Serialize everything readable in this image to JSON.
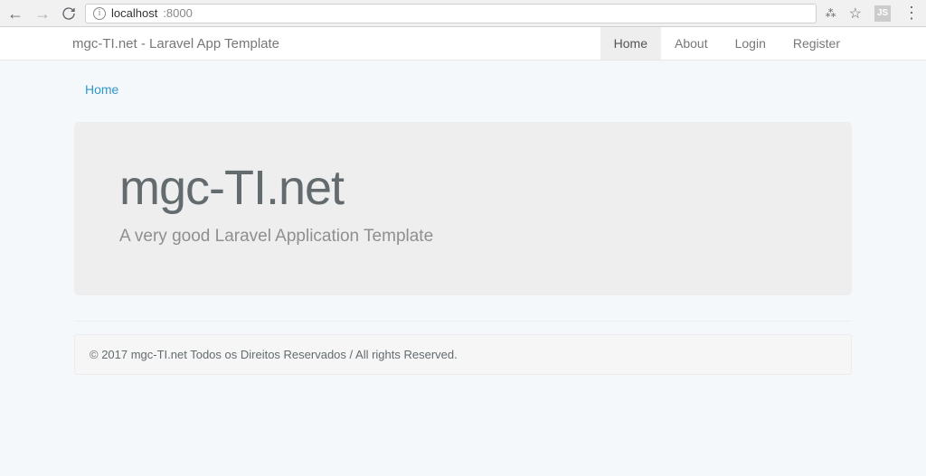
{
  "browser": {
    "url_host": "localhost",
    "url_port": ":8000"
  },
  "navbar": {
    "brand": "mgc-TI.net - Laravel App Template",
    "items": [
      {
        "label": "Home",
        "active": true
      },
      {
        "label": "About",
        "active": false
      },
      {
        "label": "Login",
        "active": false
      },
      {
        "label": "Register",
        "active": false
      }
    ]
  },
  "breadcrumb": {
    "items": [
      {
        "label": "Home"
      }
    ]
  },
  "jumbotron": {
    "title": "mgc-TI.net",
    "subtitle": "A very good Laravel Application Template"
  },
  "footer": {
    "text": "© 2017 mgc-TI.net Todos os Direitos Reservados / All rights Reserved."
  }
}
